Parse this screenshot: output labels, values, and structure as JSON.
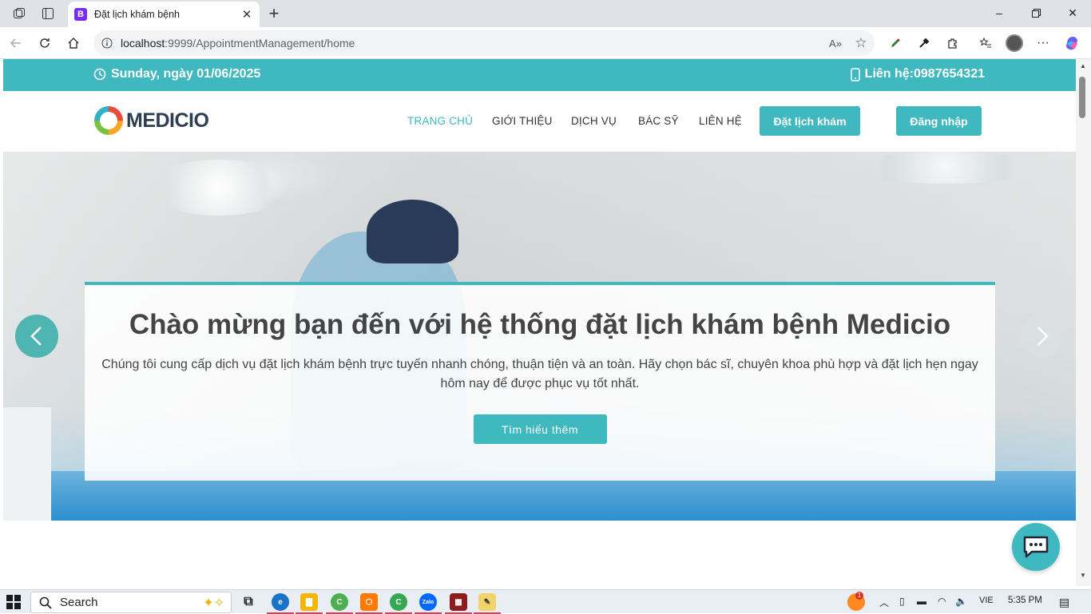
{
  "browser": {
    "tab_title": "Đặt lịch khám bệnh",
    "tab_favicon": "B",
    "url_host": "localhost",
    "url_rest": ":9999/AppointmentManagement/home",
    "read_aloud": "A»"
  },
  "site": {
    "topbar": {
      "date": "Sunday, ngày 01/06/2025",
      "contact": "Liên hệ:0987654321"
    },
    "logo": "MEDICIO",
    "nav": [
      {
        "label": "TRANG CHỦ",
        "active": true
      },
      {
        "label": "GIỚI THIỆU"
      },
      {
        "label": "DỊCH VỤ"
      },
      {
        "label": "BÁC SỸ"
      },
      {
        "label": "LIÊN HỆ"
      }
    ],
    "book_button": "Đặt lịch khám",
    "login_button": "Đăng nhập",
    "hero": {
      "title": "Chào mừng bạn đến với hệ thống đặt lịch khám bệnh Medicio",
      "subtitle": "Chúng tôi cung cấp dịch vụ đặt lịch khám bệnh trực tuyến nhanh chóng, thuận tiện và an toàn. Hãy chọn bác sĩ, chuyên khoa phù hợp và đặt lịch hẹn ngay hôm nay để được phục vụ tốt nhất.",
      "button": "Tìm hiểu thêm"
    },
    "accent": "#3fb8c0"
  },
  "taskbar": {
    "search": "Search",
    "lang": "VIE",
    "time": "5:35 PM",
    "notif_count": "1"
  }
}
